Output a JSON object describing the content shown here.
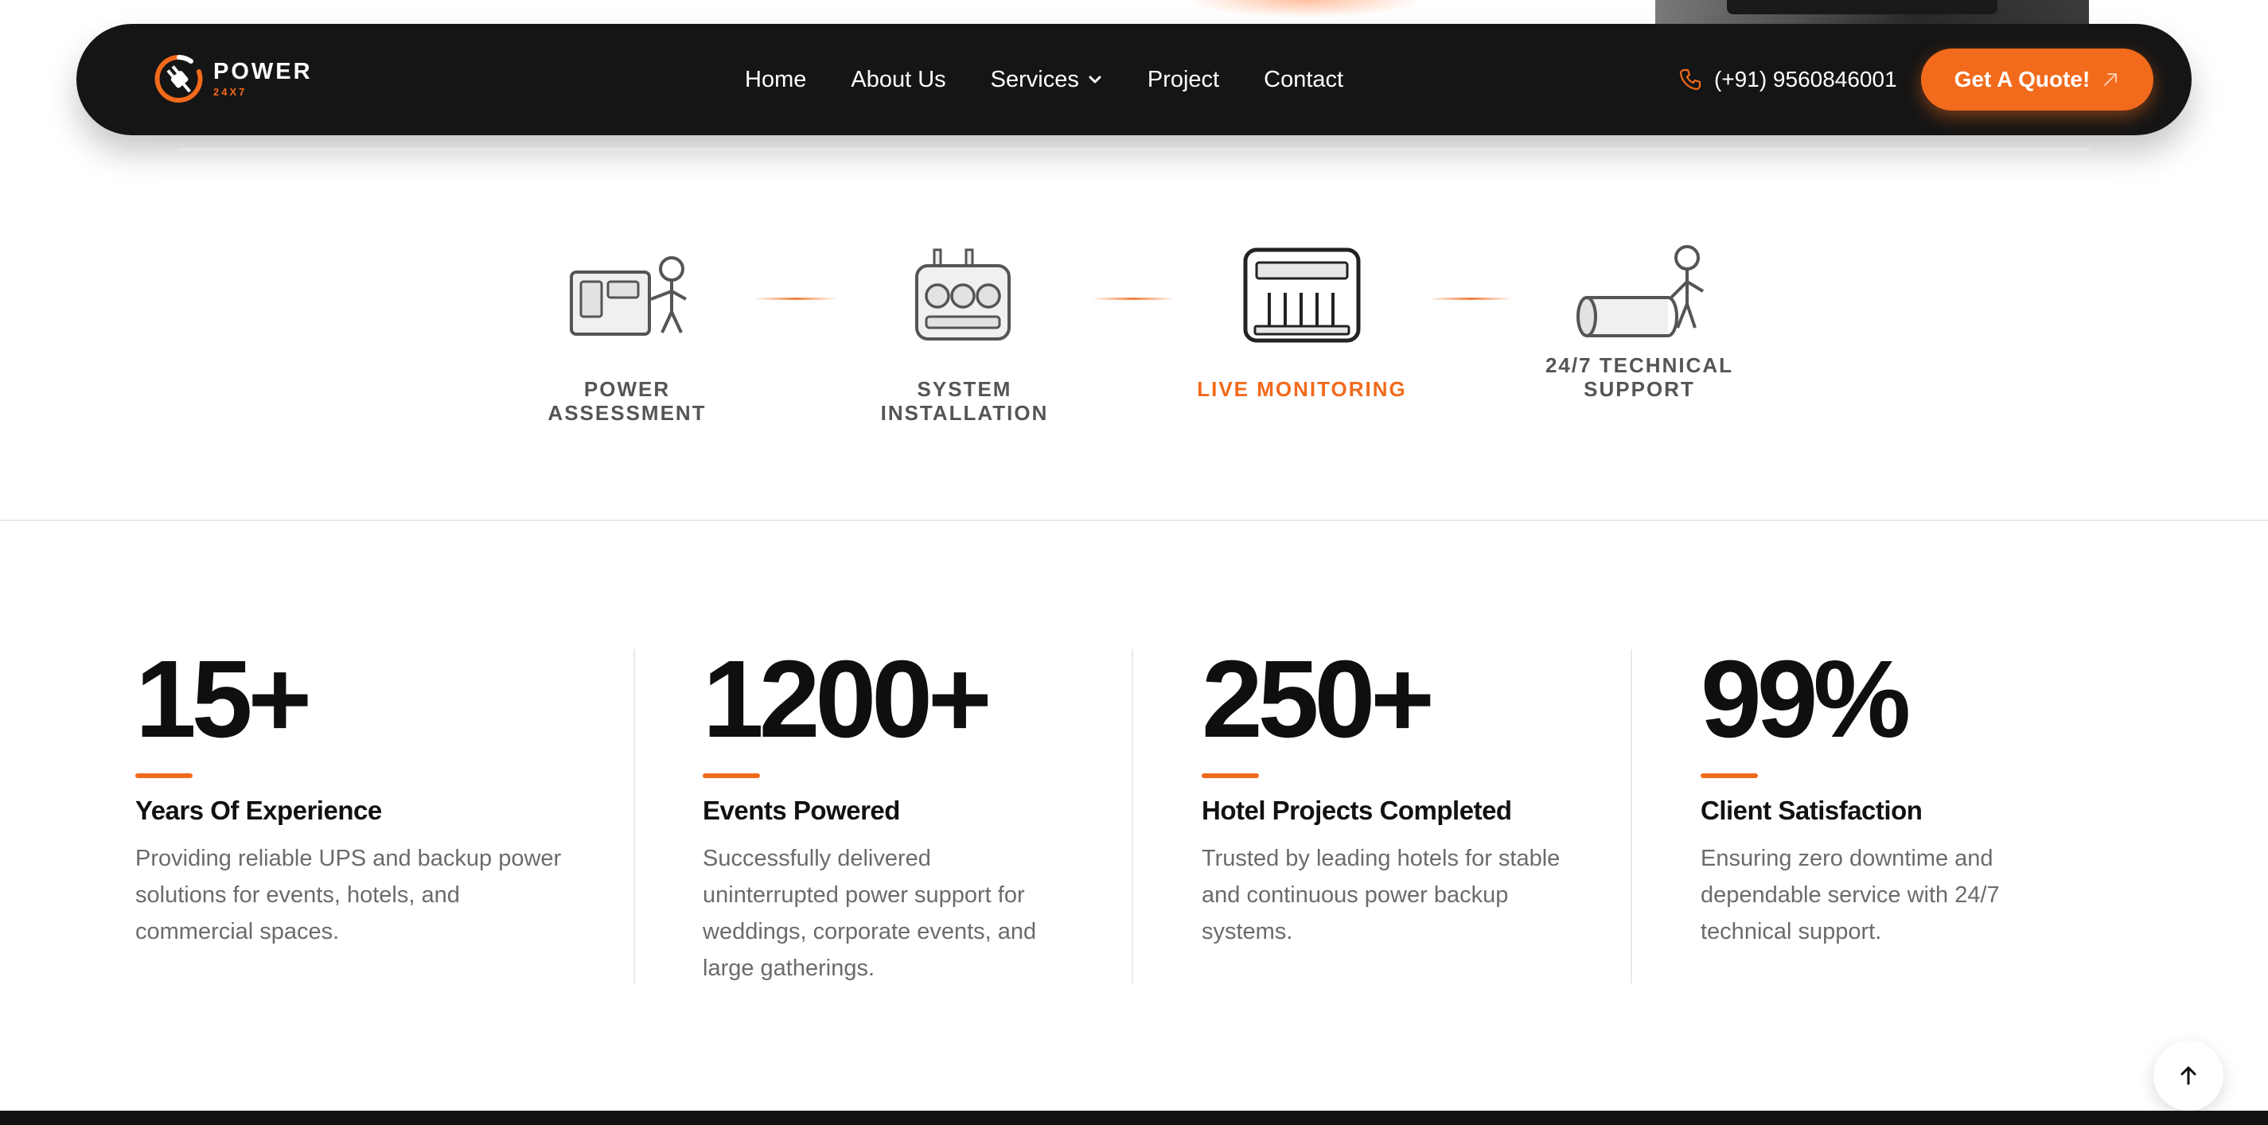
{
  "colors": {
    "accent": "#f26a1b",
    "navbar": "#151515",
    "text_dark": "#111111",
    "text_muted": "#6b6b6b"
  },
  "logo": {
    "line1": "POWER",
    "line2": "24X7",
    "icon": "power-plug-icon"
  },
  "nav": {
    "links": [
      {
        "label": "Home"
      },
      {
        "label": "About Us"
      },
      {
        "label": "Services",
        "has_dropdown": true
      },
      {
        "label": "Project"
      },
      {
        "label": "Contact"
      }
    ],
    "phone": "(+91) 9560846001",
    "quote_button": "Get A Quote!"
  },
  "process": {
    "active_index": 2,
    "steps": [
      {
        "label": "POWER ASSESSMENT",
        "icon": "power-assessment-icon"
      },
      {
        "label": "SYSTEM INSTALLATION",
        "icon": "system-installation-icon"
      },
      {
        "label": "LIVE MONITORING",
        "icon": "live-monitoring-icon"
      },
      {
        "label_line1": "24/7 TECHNICAL",
        "label_line2": "SUPPORT",
        "icon": "technical-support-icon"
      }
    ]
  },
  "stats": [
    {
      "number": "15+",
      "title": "Years Of Experience",
      "desc": [
        "Providing reliable UPS and backup power",
        "solutions for events, hotels, and",
        "commercial spaces."
      ]
    },
    {
      "number": "1200+",
      "title": "Events Powered",
      "desc": [
        "Successfully delivered",
        "uninterrupted power support for",
        "weddings, corporate events, and",
        "large gatherings."
      ]
    },
    {
      "number": "250+",
      "title": "Hotel Projects Completed",
      "desc": [
        "Trusted by leading hotels for stable",
        "and continuous power backup",
        "systems."
      ]
    },
    {
      "number": "99%",
      "title": "Client Satisfaction",
      "desc": [
        "Ensuring zero downtime and",
        "dependable service with 24/7",
        "technical support."
      ]
    }
  ]
}
